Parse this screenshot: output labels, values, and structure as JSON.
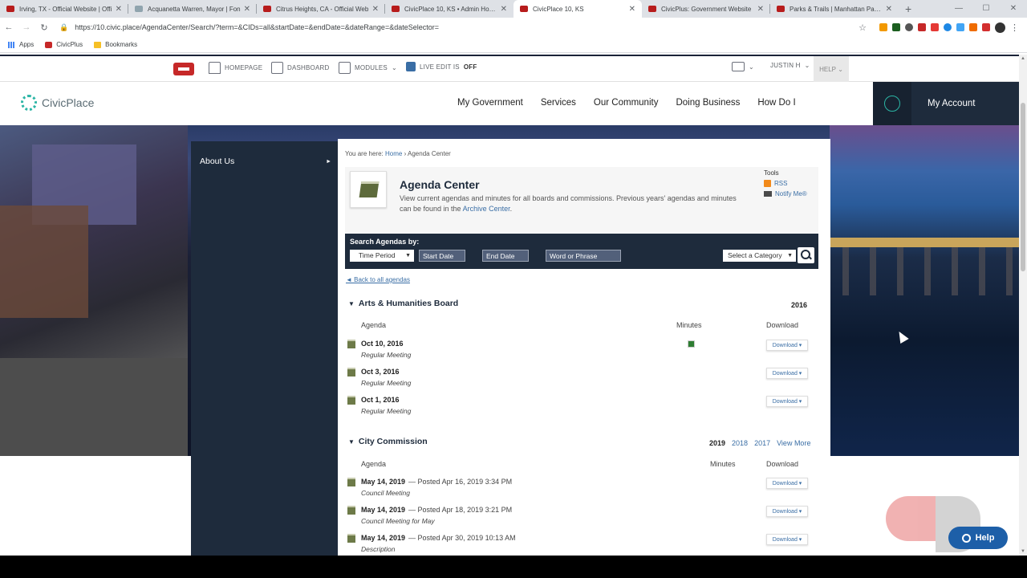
{
  "browser": {
    "tabs": [
      {
        "title": "Irving, TX - Official Website | Offi"
      },
      {
        "title": "Acquanetta Warren, Mayor | Fon"
      },
      {
        "title": "Citrus Heights, CA - Official Web"
      },
      {
        "title": "CivicPlace 10, KS • Admin Home"
      },
      {
        "title": "CivicPlace 10, KS",
        "active": true
      },
      {
        "title": "CivicPlus: Government Website"
      },
      {
        "title": "Parks & Trails | Manhattan Parks"
      }
    ],
    "new_tab": "+",
    "url": "https://10.civic.place/AgendaCenter/Search/?term=&CIDs=all&startDate=&endDate=&dateRange=&dateSelector=",
    "bookmarks": [
      "Apps",
      "CivicPlus",
      "Bookmarks"
    ]
  },
  "admin_bar": {
    "homepage": "HOMEPAGE",
    "dashboard": "DASHBOARD",
    "modules": "MODULES",
    "live_edit_label": "LIVE EDIT IS",
    "live_edit_state": "OFF",
    "user": "JUSTIN H",
    "help": "HELP"
  },
  "site": {
    "logo_text": "CivicPlace",
    "nav": [
      "My Government",
      "Services",
      "Our Community",
      "Doing Business",
      "How Do I"
    ],
    "account": "My Account"
  },
  "sidebar": {
    "items": [
      {
        "label": "About Us"
      }
    ]
  },
  "breadcrumb": {
    "prefix": "You are here:",
    "home": "Home",
    "sep": "›",
    "current": "Agenda Center"
  },
  "page": {
    "title": "Agenda Center",
    "desc_text": "View current agendas and minutes for all boards and commissions. Previous years' agendas and minutes can be found in the",
    "archive_link": "Archive Center",
    "desc_end": ".",
    "tools_label": "Tools",
    "rss": "RSS",
    "notify": "Notify Me®"
  },
  "search": {
    "label": "Search Agendas by:",
    "time_period": "Time Period",
    "start_date": "Start Date",
    "end_date": "End Date",
    "word": "Word or Phrase",
    "category": "Select a Category"
  },
  "back_link": "◄ Back to all agendas",
  "sections": [
    {
      "title": "Arts & Humanities Board",
      "years": [
        "2016"
      ],
      "columns": {
        "agenda": "Agenda",
        "minutes": "Minutes",
        "download": "Download"
      },
      "rows": [
        {
          "date": "Oct 10, 2016",
          "posted": "",
          "type": "Regular Meeting",
          "has_minutes": true,
          "download": "Download ▾"
        },
        {
          "date": "Oct 3, 2016",
          "posted": "",
          "type": "Regular Meeting",
          "has_minutes": false,
          "download": "Download ▾"
        },
        {
          "date": "Oct 1, 2016",
          "posted": "",
          "type": "Regular Meeting",
          "has_minutes": false,
          "download": "Download ▾"
        }
      ]
    },
    {
      "title": "City Commission",
      "years": [
        "2019",
        "2018",
        "2017",
        "View More"
      ],
      "columns": {
        "agenda": "Agenda",
        "minutes": "Minutes",
        "download": "Download"
      },
      "rows": [
        {
          "date": "May 14, 2019",
          "posted": "— Posted Apr 16, 2019 3:34 PM",
          "type": "Council Meeting",
          "has_minutes": false,
          "download": "Download ▾"
        },
        {
          "date": "May 14, 2019",
          "posted": "— Posted Apr 18, 2019 3:21 PM",
          "type": "Council Meeting for May",
          "has_minutes": false,
          "download": "Download ▾"
        },
        {
          "date": "May 14, 2019",
          "posted": "— Posted Apr 30, 2019 10:13 AM",
          "type": "Description",
          "has_minutes": false,
          "download": "Download ▾"
        }
      ]
    }
  ],
  "help_button": "Help",
  "colors": {
    "navy": "#1e2b3c",
    "link": "#3a6ea5",
    "teal": "#2bb5a5",
    "brand_red": "#c62828"
  }
}
